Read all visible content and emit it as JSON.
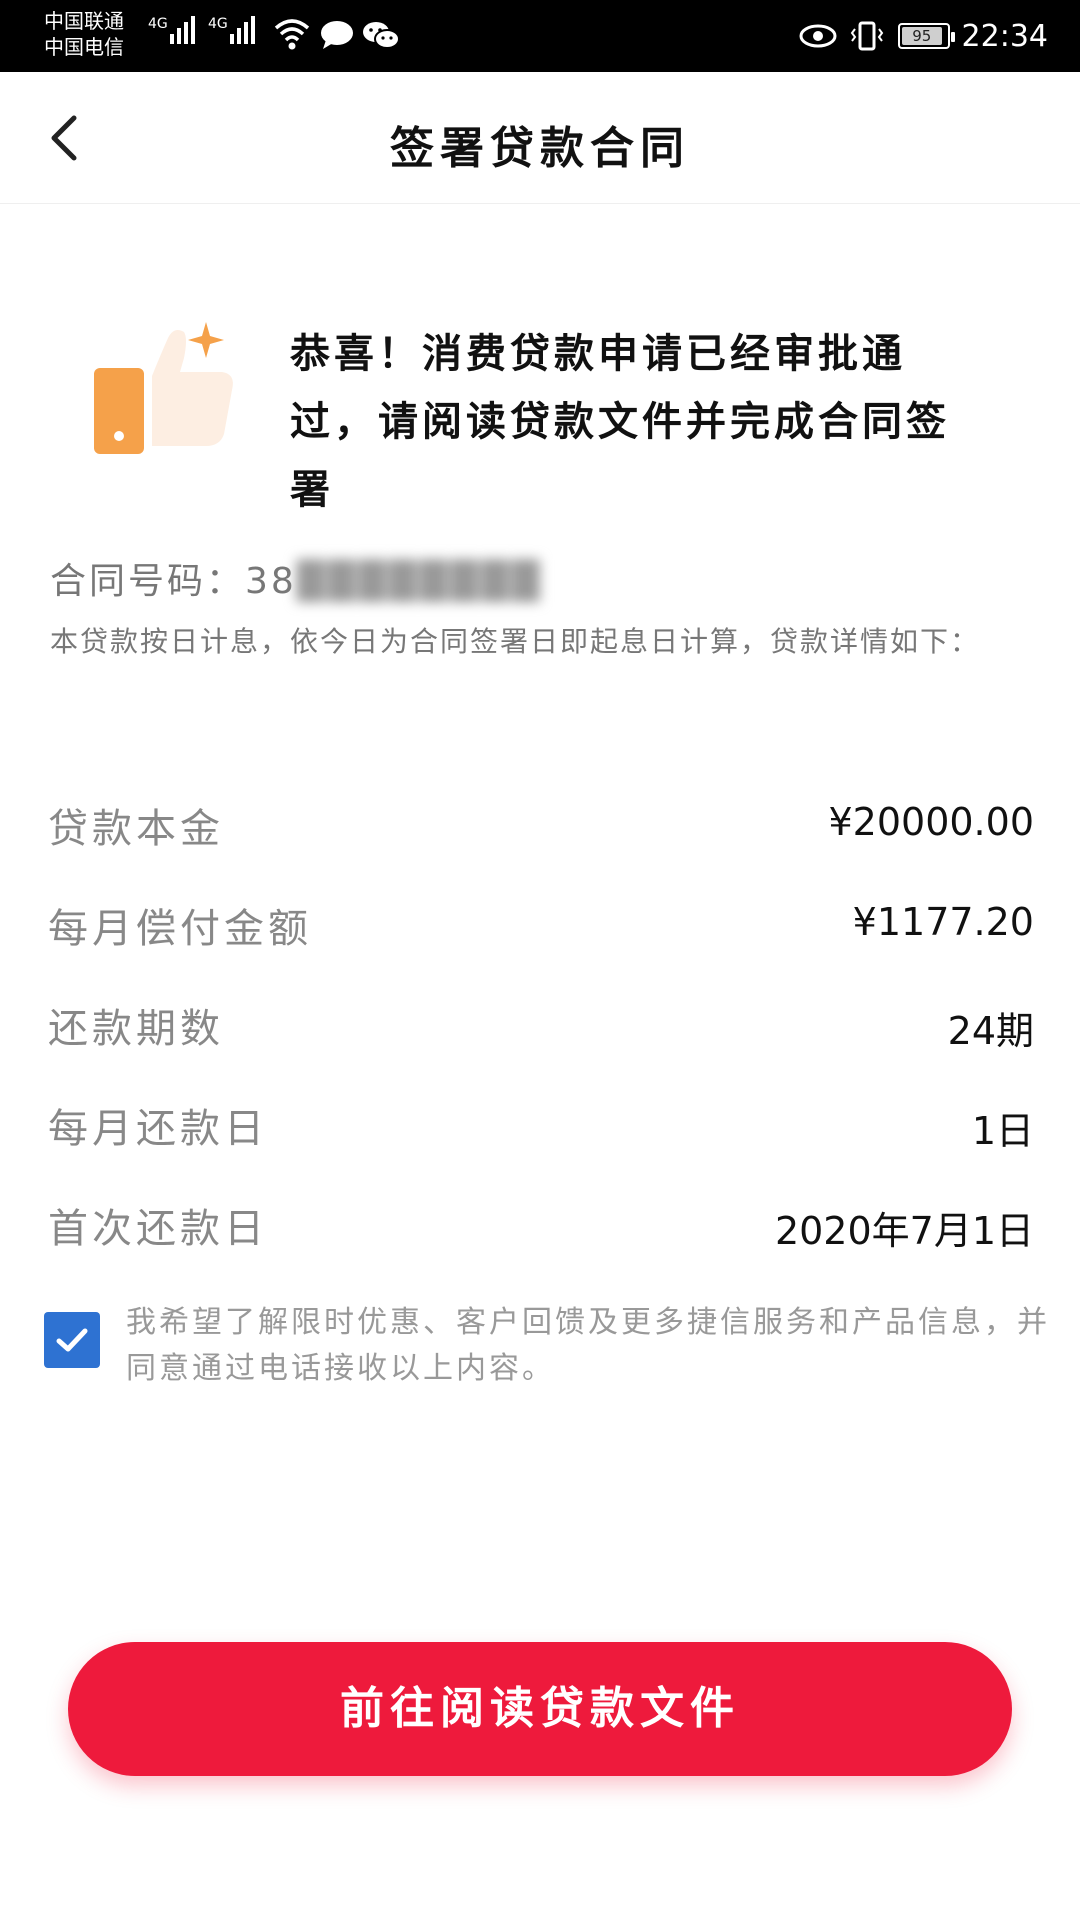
{
  "status_bar": {
    "carrier1": "中国联通",
    "carrier2": "中国电信",
    "network_tag1": "4G",
    "network_tag2": "4G",
    "battery_level": "95",
    "time": "22:34"
  },
  "nav": {
    "title": "签署贷款合同",
    "back_icon": "chevron-left-icon"
  },
  "hero": {
    "icon": "thumbs-up-phone-icon",
    "message": "恭喜！消费贷款申请已经审批通过，请阅读贷款文件并完成合同签署"
  },
  "contract": {
    "label": "合同号码：",
    "number_visible": "38",
    "number_masked": "████████"
  },
  "interest_note": "本贷款按日计息，依今日为合同签署日即起息日计算，贷款详情如下：",
  "details": [
    {
      "label": "贷款本金",
      "value": "¥20000.00"
    },
    {
      "label": "每月偿付金额",
      "value": "¥1177.20"
    },
    {
      "label": "还款期数",
      "value": "24期"
    },
    {
      "label": "每月还款日",
      "value": "1日"
    },
    {
      "label": "首次还款日",
      "value": "2020年7月1日"
    }
  ],
  "consent": {
    "checked": true,
    "text": "我希望了解限时优惠、客户回馈及更多捷信服务和产品信息，并同意通过电话接收以上内容。"
  },
  "primary_button": {
    "label": "前往阅读贷款文件"
  },
  "colors": {
    "accent_red": "#ee1a3c",
    "checkbox_blue": "#2e72d2",
    "icon_orange": "#f5a14a"
  }
}
